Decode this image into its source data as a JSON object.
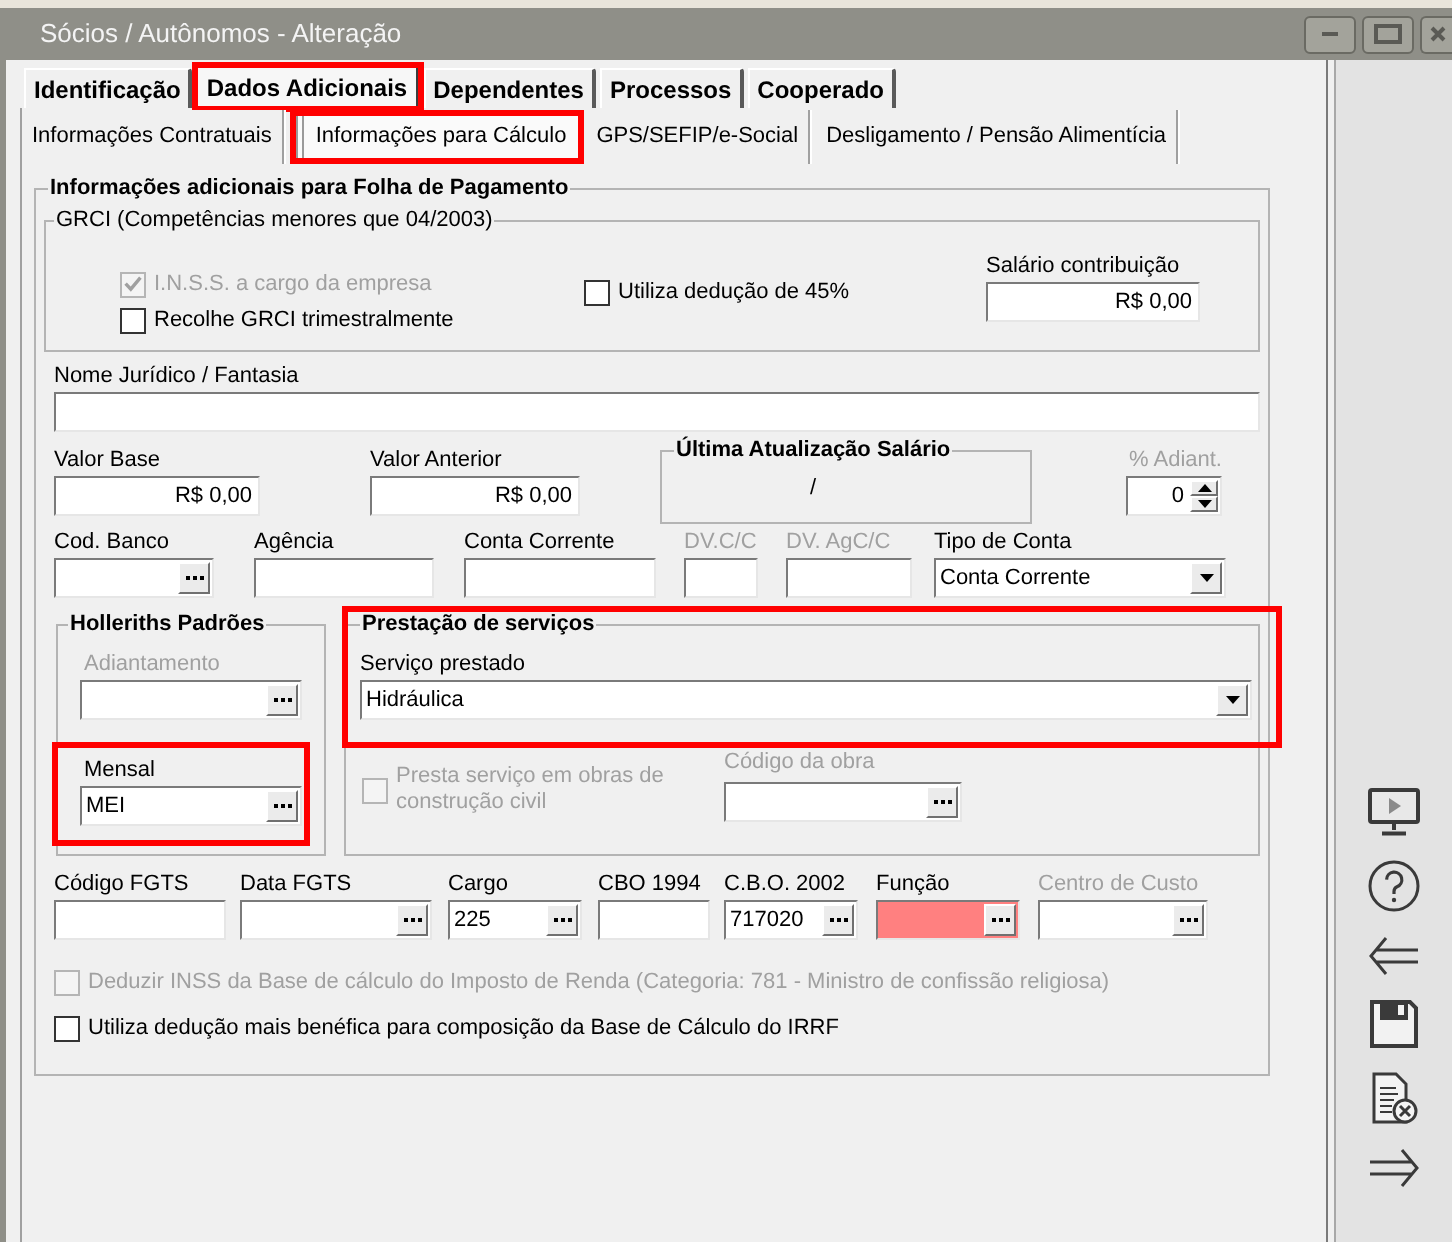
{
  "window": {
    "title": "Sócios / Autônomos - Alteração"
  },
  "tabs": [
    {
      "label": "Identificação",
      "selected": false,
      "highlighted": false
    },
    {
      "label": "Dados Adicionais",
      "selected": true,
      "highlighted": true
    },
    {
      "label": "Dependentes",
      "selected": false,
      "highlighted": false
    },
    {
      "label": "Processos",
      "selected": false,
      "highlighted": false
    },
    {
      "label": "Cooperado",
      "selected": false,
      "highlighted": false
    }
  ],
  "subtabs": [
    {
      "label": "Informações Contratuais",
      "selected": false,
      "highlighted": false
    },
    {
      "label": "Informações para Cálculo",
      "selected": true,
      "highlighted": true
    },
    {
      "label": "GPS/SEFIP/e-Social",
      "selected": false,
      "highlighted": false
    },
    {
      "label": "Desligamento / Pensão Alimentícia",
      "selected": false,
      "highlighted": false
    }
  ],
  "panel": {
    "title": "Informações adicionais para Folha de Pagamento"
  },
  "grci": {
    "title": "GRCI (Competências menores que 04/2003)",
    "checkboxes": [
      {
        "label": "I.N.S.S. a cargo da empresa",
        "checked": true,
        "disabled": true
      },
      {
        "label": "Recolhe GRCI trimestralmente",
        "checked": false,
        "disabled": false
      },
      {
        "label": "Utiliza dedução de 45%",
        "checked": false,
        "disabled": false
      }
    ],
    "salary": {
      "label": "Salário contribuição",
      "value": "R$ 0,00"
    }
  },
  "legal_name": {
    "label": "Nome Jurídico / Fantasia"
  },
  "salary_row": {
    "base": {
      "label": "Valor Base",
      "value": "R$ 0,00"
    },
    "previous": {
      "label": "Valor Anterior",
      "value": "R$ 0,00"
    },
    "last_update": {
      "title": "Última Atualização Salário",
      "value": "/"
    },
    "advance_pct": {
      "label": "% Adiant.",
      "value": "0",
      "disabled": true
    }
  },
  "bank_fields": [
    {
      "label": "Cod. Banco",
      "kind": "lookup",
      "disabled": false
    },
    {
      "label": "Agência",
      "kind": "text",
      "disabled": false
    },
    {
      "label": "Conta Corrente",
      "kind": "text",
      "disabled": false
    },
    {
      "label": "DV.C/C",
      "kind": "text",
      "disabled": true
    },
    {
      "label": "DV. AgC/C",
      "kind": "text",
      "disabled": true
    },
    {
      "label": "Tipo de Conta",
      "kind": "dropdown",
      "value": "Conta Corrente",
      "disabled": false
    }
  ],
  "holleriths": {
    "title": "Holleriths Padrões",
    "fields": [
      {
        "label": "Adiantamento",
        "disabled": true,
        "highlighted": false
      },
      {
        "label": "Mensal",
        "value": "MEI",
        "disabled": false,
        "highlighted": true
      }
    ]
  },
  "services": {
    "title": "Prestação de serviços",
    "highlighted": true,
    "service": {
      "label": "Serviço prestado",
      "value": "Hidráulica"
    },
    "construction": {
      "label": "Presta serviço em obras de construção civil",
      "checked": false,
      "disabled": true
    },
    "work_code": {
      "label": "Código da obra",
      "disabled": true
    }
  },
  "codes": [
    {
      "label": "Código FGTS",
      "kind": "text",
      "disabled": false,
      "invalid": false
    },
    {
      "label": "Data FGTS",
      "kind": "lookup",
      "disabled": false,
      "invalid": false
    },
    {
      "label": "Cargo",
      "kind": "lookup",
      "value": "225",
      "disabled": false,
      "invalid": false
    },
    {
      "label": "CBO 1994",
      "kind": "text",
      "disabled": false,
      "invalid": false
    },
    {
      "label": "C.B.O. 2002",
      "kind": "lookup",
      "value": "717020",
      "disabled": false,
      "invalid": false
    },
    {
      "label": "Função",
      "kind": "lookup",
      "disabled": false,
      "invalid": true
    },
    {
      "label": "Centro de Custo",
      "kind": "lookup",
      "disabled": true,
      "invalid": false
    }
  ],
  "options": [
    {
      "label": "Deduzir INSS da Base de cálculo do Imposto de Renda (Categoria: 781 - Ministro de confissão religiosa)",
      "checked": false,
      "disabled": true
    },
    {
      "label": "Utiliza dedução mais benéfica para composição da Base de Cálculo do IRRF",
      "checked": false,
      "disabled": false
    }
  ]
}
